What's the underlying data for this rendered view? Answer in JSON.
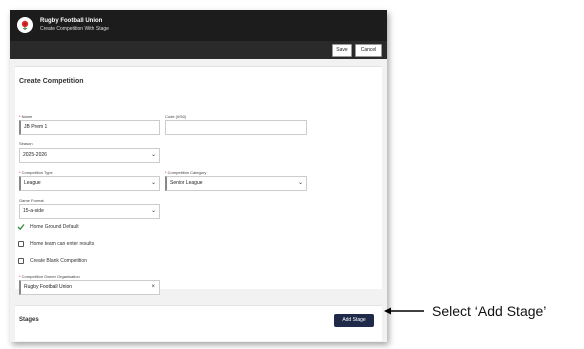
{
  "app": {
    "brand": "Rugby Football Union",
    "subtitle": "Create Competition With Stage",
    "logo_icon": "rose-emblem-icon"
  },
  "toolbar": {
    "save_label": "Save",
    "cancel_label": "Cancel"
  },
  "form": {
    "title": "Create Competition",
    "name_label": "Name",
    "name_value": "JB Prem 1",
    "code_label": "Code (0/50)",
    "code_value": "",
    "season_label": "Season",
    "season_value": "2025-2026",
    "type_label": "Competition Type",
    "type_value": "League",
    "category_label": "Competition Category",
    "category_value": "Senior League",
    "format_label": "Game Format",
    "format_value": "15-a-side",
    "checkboxes": [
      {
        "label": "Home Ground Default",
        "checked": true
      },
      {
        "label": "Home team can enter results",
        "checked": false
      },
      {
        "label": "Create Blank Competition",
        "checked": false
      }
    ],
    "owner_label": "Competition Owner Organisation",
    "owner_value": "Rugby Football Union"
  },
  "stages": {
    "title": "Stages",
    "add_label": "Add Stage"
  },
  "annotation": {
    "text": "Select ‘Add Stage’"
  },
  "colors": {
    "topbar": "#1c1c1c",
    "add_stage_button": "#1f2a4a",
    "check_green": "#2e8b3e"
  }
}
